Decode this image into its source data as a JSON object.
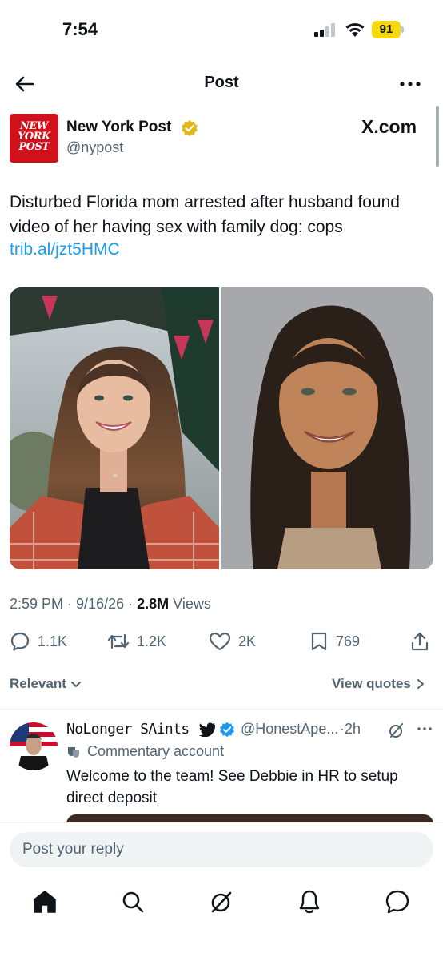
{
  "status_bar": {
    "time": "7:54",
    "battery": "91"
  },
  "navbar": {
    "title": "Post"
  },
  "tweet": {
    "author_name": "New York Post",
    "handle": "@nypost",
    "avatar_text": [
      "NEW",
      "YORK",
      "POST"
    ],
    "source_logo": "X.com",
    "text": "Disturbed Florida mom arrested after husband found video of her having sex with family dog: cops",
    "link": "trib.al/jzt5HMC",
    "time": "2:59 PM",
    "date": "9/16/26",
    "views_count": "2.8M",
    "views_label": "Views",
    "stats": {
      "replies": "1.1K",
      "reposts": "1.2K",
      "likes": "2K",
      "bookmarks": "769"
    }
  },
  "filters": {
    "relevant_label": "Relevant",
    "view_quotes_label": "View quotes"
  },
  "reply": {
    "name": "NoLonger SΛints",
    "handle": "@HonestApe...",
    "time": "2h",
    "label": "Commentary account",
    "text": "Welcome to the team! See Debbie in HR to setup direct deposit"
  },
  "composer": {
    "placeholder": "Post your reply"
  },
  "colors": {
    "link": "#1d9bf0",
    "secondary_text": "#536471",
    "verified_gold": "#e2b719",
    "verified_blue": "#1d9bf0",
    "brand_red": "#d0101a"
  },
  "icons": [
    "back-arrow-icon",
    "more-icon",
    "verified-gold-icon",
    "reply-icon",
    "repost-icon",
    "like-icon",
    "bookmark-icon",
    "share-icon",
    "home-icon",
    "search-icon",
    "grok-icon",
    "notifications-icon",
    "messages-icon"
  ]
}
